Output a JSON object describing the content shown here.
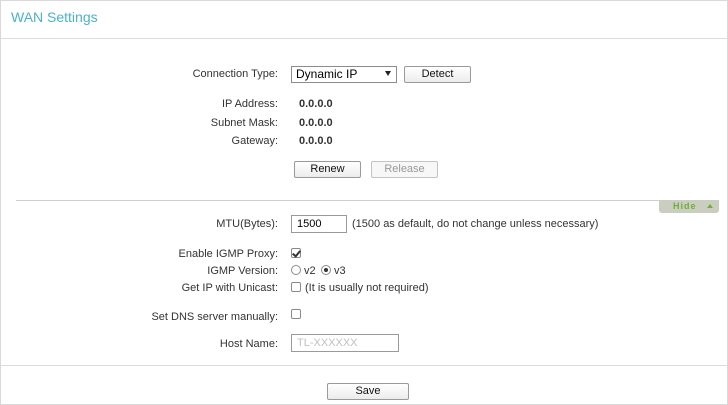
{
  "header": {
    "title": "WAN Settings"
  },
  "connection": {
    "label": "Connection Type:",
    "selected": "Dynamic IP",
    "detect_label": "Detect"
  },
  "status": {
    "ip_label": "IP Address:",
    "ip_value": "0.0.0.0",
    "mask_label": "Subnet Mask:",
    "mask_value": "0.0.0.0",
    "gateway_label": "Gateway:",
    "gateway_value": "0.0.0.0"
  },
  "actions": {
    "renew_label": "Renew",
    "release_label": "Release"
  },
  "advanced": {
    "hide_label": "Hide",
    "mtu_label": "MTU(Bytes):",
    "mtu_value": "1500",
    "mtu_note": "(1500 as default, do not change unless necessary)",
    "igmp_proxy_label": "Enable IGMP Proxy:",
    "igmp_proxy_checked": true,
    "igmp_version_label": "IGMP Version:",
    "igmp_v2_label": "v2",
    "igmp_v3_label": "v3",
    "igmp_selected": "v3",
    "unicast_label": "Get IP with Unicast:",
    "unicast_note": "(It is usually not required)",
    "unicast_checked": false,
    "dns_label": "Set DNS server manually:",
    "dns_checked": false,
    "host_label": "Host Name:",
    "host_value": "TL-XXXXXX"
  },
  "footer": {
    "save_label": "Save"
  },
  "colors": {
    "title": "#4bb3c9",
    "hide_text": "#6fae3a",
    "hide_bg": "#c9cec0"
  }
}
